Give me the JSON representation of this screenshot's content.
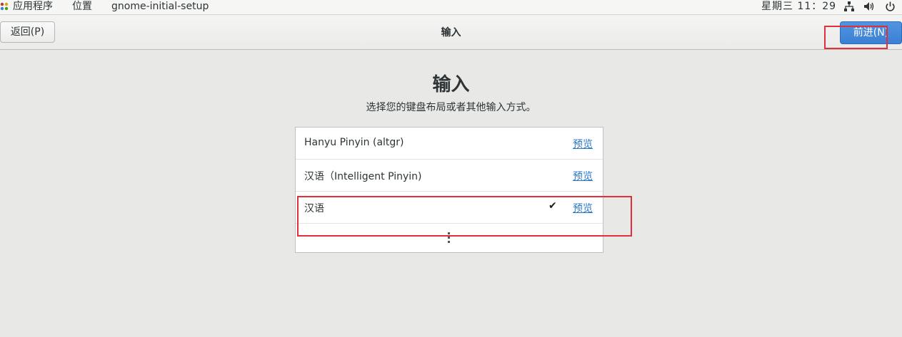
{
  "top_panel": {
    "apps_label": "应用程序",
    "places_label": "位置",
    "app_name": "gnome-initial-setup",
    "clock": "星期三 11：29",
    "icons": [
      "apps-icon",
      "network-icon",
      "volume-icon",
      "power-icon"
    ]
  },
  "header": {
    "back_label": "返回(P)",
    "title": "输入",
    "next_label": "前进(N)"
  },
  "main": {
    "title": "输入",
    "subtitle": "选择您的键盘布局或者其他输入方式。",
    "inputs": [
      {
        "label": "Hanyu Pinyin (altgr)",
        "preview": "预览",
        "selected": false
      },
      {
        "label": "汉语（Intelligent Pinyin)",
        "preview": "预览",
        "selected": false
      },
      {
        "label": "汉语",
        "preview": "预览",
        "selected": true
      }
    ],
    "more_icon": "more-vertical-icon"
  },
  "colors": {
    "accent": "#3a80d4",
    "link": "#2a76c6",
    "annotation": "#e0303a",
    "background": "#e8e8e7"
  }
}
